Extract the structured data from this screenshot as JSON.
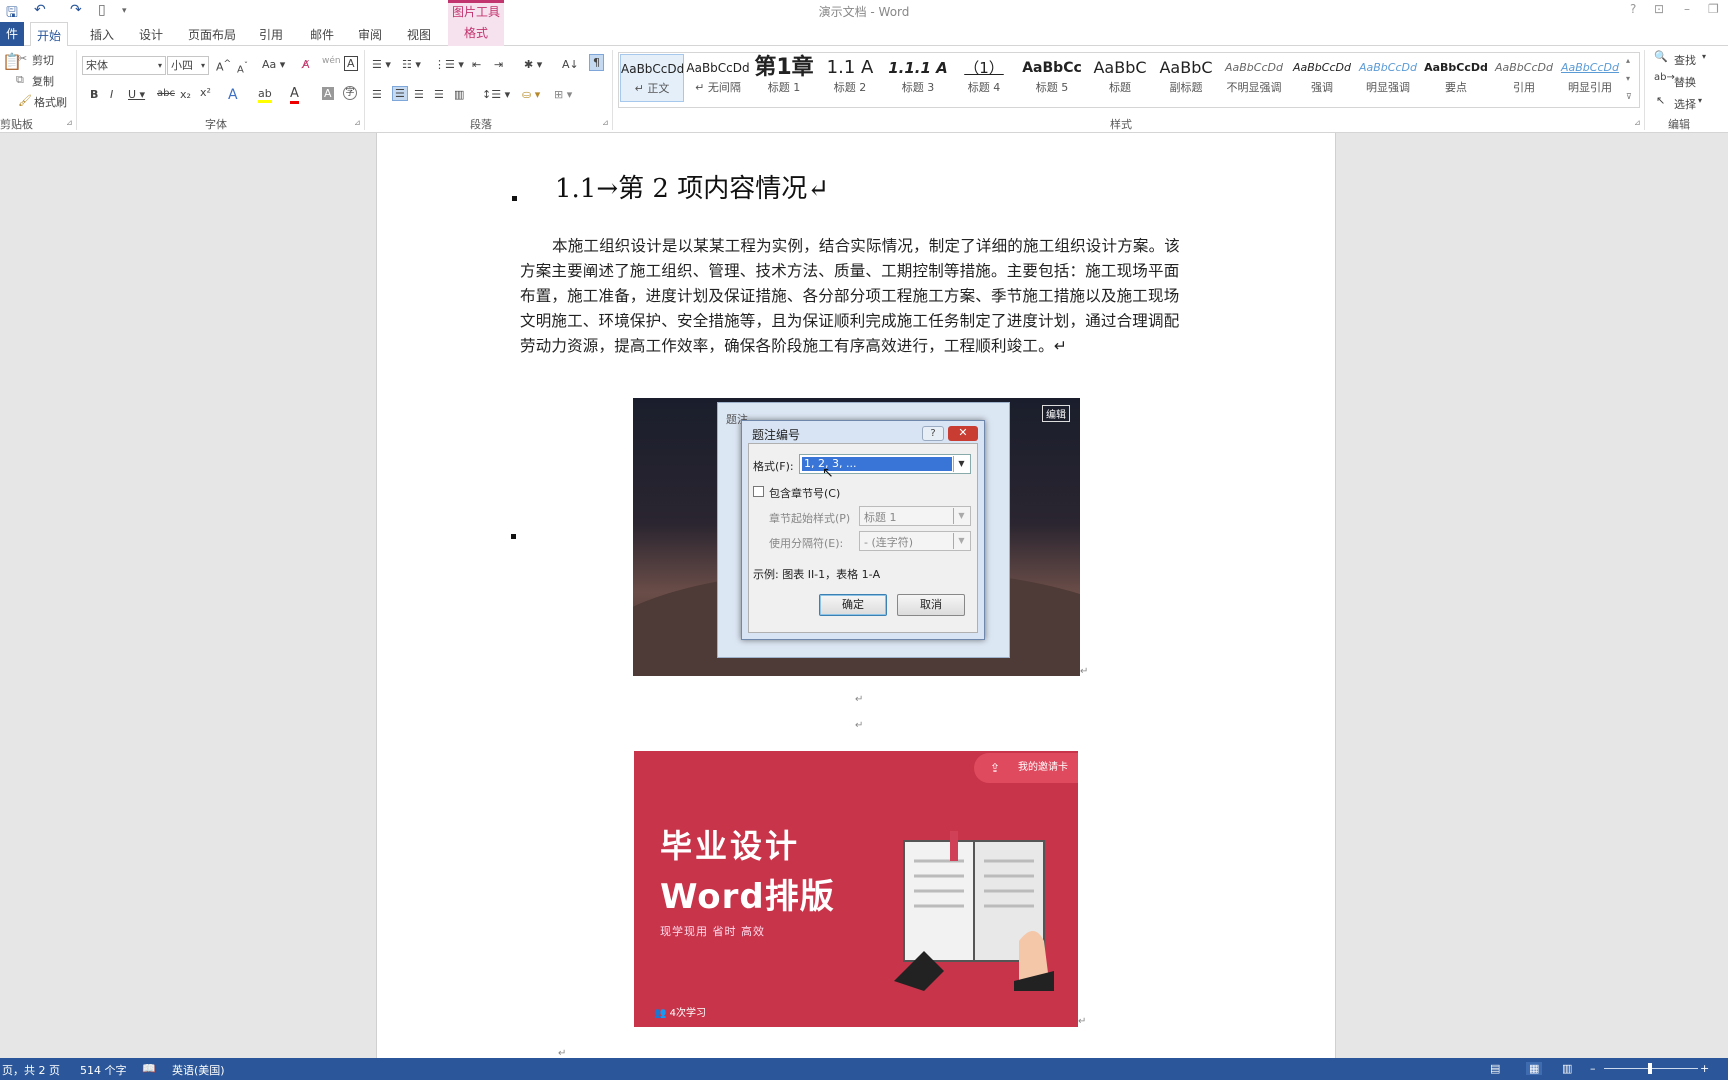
{
  "window": {
    "title": "演示文档 - Word",
    "contextual_tab_group": "图片工具"
  },
  "tabs": [
    "件",
    "开始",
    "插入",
    "设计",
    "页面布局",
    "引用",
    "邮件",
    "审阅",
    "视图",
    "格式"
  ],
  "ribbon": {
    "clipboard": {
      "cut": "剪切",
      "copy": "复制",
      "painter": "格式刷",
      "label": "剪贴板"
    },
    "font": {
      "name": "宋体",
      "size": "小四",
      "label": "字体"
    },
    "paragraph": {
      "label": "段落"
    },
    "styles": {
      "label": "样式",
      "items": [
        {
          "preview": "AaBbCcDd",
          "name": "↵ 正文"
        },
        {
          "preview": "AaBbCcDd",
          "name": "↵ 无间隔"
        },
        {
          "preview": "第1章",
          "name": "标题 1"
        },
        {
          "preview": "1.1  A",
          "name": "标题 2"
        },
        {
          "preview": "1.1.1  A",
          "name": "标题 3"
        },
        {
          "preview": "（1）",
          "name": "标题 4"
        },
        {
          "preview": "AaBbCc",
          "name": "标题 5"
        },
        {
          "preview": "AaBbC",
          "name": "标题"
        },
        {
          "preview": "AaBbC",
          "name": "副标题"
        },
        {
          "preview": "AaBbCcDd",
          "name": "不明显强调"
        },
        {
          "preview": "AaBbCcDd",
          "name": "强调"
        },
        {
          "preview": "AaBbCcDd",
          "name": "明显强调"
        },
        {
          "preview": "AaBbCcDd",
          "name": "要点"
        },
        {
          "preview": "AaBbCcDd",
          "name": "引用"
        },
        {
          "preview": "AaBbCcDd",
          "name": "明显引用"
        }
      ]
    },
    "editing": {
      "find": "查找",
      "replace": "替换",
      "select": "选择",
      "label": "编辑"
    }
  },
  "document": {
    "heading": "1.1→第 2 项内容情况↵",
    "paragraph": "本施工组织设计是以某某工程为实例，结合实际情况，制定了详细的施工组织设计方案。该方案主要阐述了施工组织、管理、技术方法、质量、工期控制等措施。主要包括：施工现场平面布置，施工准备，进度计划及保证措施、各分部分项工程施工方案、季节施工措施以及施工现场文明施工、环境保护、安全措施等，且为保证顺利完成施工任务制定了进度计划，通过合理调配劳动力资源，提高工作效率，确保各阶段施工有序高效进行，工程顺利竣工。↵",
    "image1_tag": "编辑",
    "image2": {
      "title1": "毕业设计",
      "title2": "Word排版",
      "subtitle": "现学现用  省时  高效",
      "footer": "4次学习",
      "card": "我的邀请卡"
    }
  },
  "dialog_back": {
    "title": "题注"
  },
  "dialog": {
    "title": "题注编号",
    "help": "?",
    "close": "✕",
    "format_label": "格式(F):",
    "format_value": "1, 2, 3, ...",
    "include_chapter": "包含章节号(C)",
    "chapter_style_label": "章节起始样式(P)",
    "chapter_style_value": "标题 1",
    "separator_label": "使用分隔符(E):",
    "separator_value": "-  (连字符)",
    "example": "示例:  图表 II-1，表格 1-A",
    "ok": "确定",
    "cancel": "取消"
  },
  "statusbar": {
    "page": "页，共 2 页",
    "words": "514 个字",
    "language": "英语(美国)"
  }
}
